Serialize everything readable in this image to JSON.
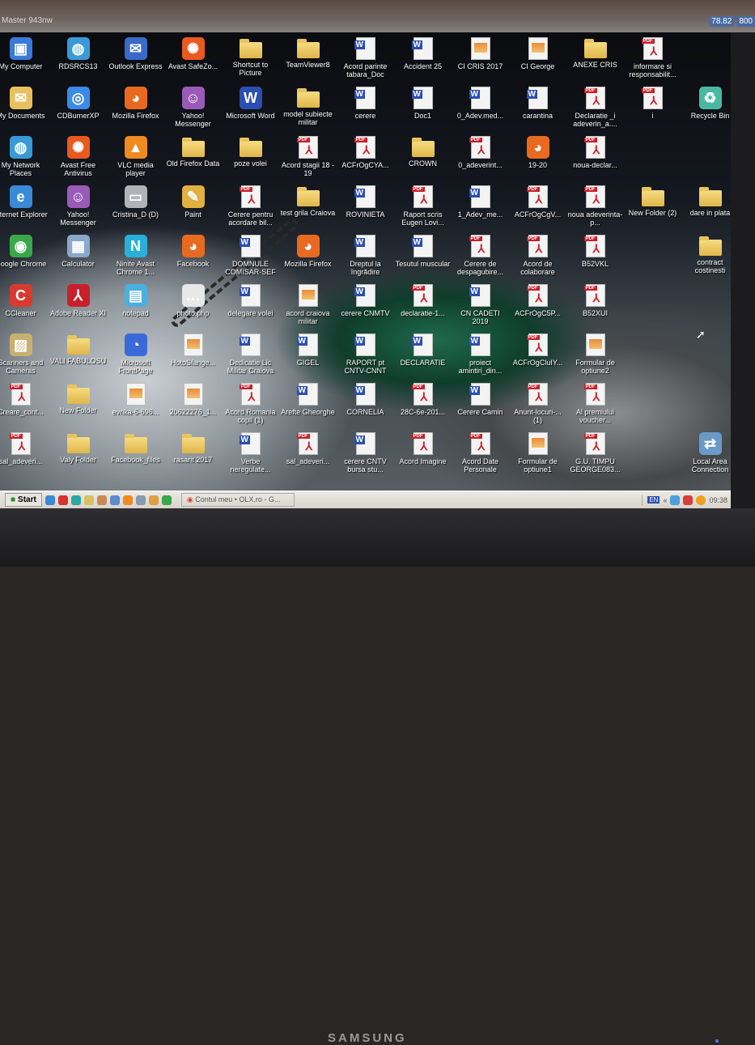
{
  "monitor": {
    "model": "Master 943nw",
    "osd": [
      "78.82",
      "800"
    ],
    "brand": "SAMSUNG"
  },
  "desktop": {
    "rows": [
      [
        {
          "label": "My Computer",
          "icon": "computer"
        },
        {
          "label": "RDSRCS13",
          "icon": "network"
        },
        {
          "label": "Outlook Express",
          "icon": "outlook"
        },
        {
          "label": "Avast SafeZo...",
          "icon": "avast"
        },
        {
          "label": "Shortcut to Picture",
          "icon": "folder"
        },
        {
          "label": "TeamViewer8",
          "icon": "folder"
        },
        {
          "label": "Acord parinte tabara_Doc",
          "icon": "word"
        },
        {
          "label": "Accident 25",
          "icon": "word"
        },
        {
          "label": "CI CRIS 2017",
          "icon": "img"
        },
        {
          "label": "CI George",
          "icon": "img"
        },
        {
          "label": "ANEXE CRIS",
          "icon": "folder"
        },
        {
          "label": "informare si responsabilit...",
          "icon": "pdf"
        },
        null
      ],
      [
        {
          "label": "My Documents",
          "icon": "documents"
        },
        {
          "label": "CDBurnerXP",
          "icon": "cdburner"
        },
        {
          "label": "Mozilla Firefox",
          "icon": "firefox"
        },
        {
          "label": "Yahoo! Messenger",
          "icon": "yahoo"
        },
        {
          "label": "Microsoft Word",
          "icon": "msword"
        },
        {
          "label": "model subiecte militar",
          "icon": "folder"
        },
        {
          "label": "cerere",
          "icon": "word"
        },
        {
          "label": "Doc1",
          "icon": "word"
        },
        {
          "label": "0_Adev.med...",
          "icon": "word"
        },
        {
          "label": "carantina",
          "icon": "word"
        },
        {
          "label": "Declaratie _i adeverin_a....",
          "icon": "pdf"
        },
        {
          "label": "i",
          "icon": "pdf"
        },
        {
          "label": "Recycle Bin",
          "icon": "recycle"
        }
      ],
      [
        {
          "label": "My Network Places",
          "icon": "network"
        },
        {
          "label": "Avast Free Antivirus",
          "icon": "avast"
        },
        {
          "label": "VLC media player",
          "icon": "vlc"
        },
        {
          "label": "Old Firefox Data",
          "icon": "folder"
        },
        {
          "label": "poze volei",
          "icon": "folder"
        },
        {
          "label": "Acord stagii 18 - 19",
          "icon": "pdf"
        },
        {
          "label": "ACFrOgCYA...",
          "icon": "pdf"
        },
        {
          "label": "CROWN",
          "icon": "folder"
        },
        {
          "label": "0_adeverint...",
          "icon": "pdf"
        },
        {
          "label": "19-20",
          "icon": "firefox"
        },
        {
          "label": "noua-declar...",
          "icon": "pdf"
        },
        null,
        null
      ],
      [
        {
          "label": "Internet Explorer",
          "icon": "ie"
        },
        {
          "label": "Yahoo! Messenger",
          "icon": "yahoo"
        },
        {
          "label": "Cristina_D (D)",
          "icon": "drive"
        },
        {
          "label": "Paint",
          "icon": "paint"
        },
        {
          "label": "Cerere pentru acordare bil...",
          "icon": "pdf"
        },
        {
          "label": "test grila Craiova",
          "icon": "folder"
        },
        {
          "label": "ROVINIETA",
          "icon": "word"
        },
        {
          "label": "Raport scris Eugen Lovi...",
          "icon": "pdf"
        },
        {
          "label": "1_Adev_me...",
          "icon": "word"
        },
        {
          "label": "ACFrOgCgV...",
          "icon": "pdf"
        },
        {
          "label": "noua adeverinta-p...",
          "icon": "pdf"
        },
        {
          "label": "New Folder (2)",
          "icon": "folder"
        },
        {
          "label": "dare in plata",
          "icon": "folder"
        }
      ],
      [
        {
          "label": "Google Chrome",
          "icon": "chrome"
        },
        {
          "label": "Calculator",
          "icon": "calculator"
        },
        {
          "label": "Ninite Avast Chrome 1...",
          "icon": "ninite"
        },
        {
          "label": "Facebook",
          "icon": "firefox"
        },
        {
          "label": "DOMNULE COMISAR-SEF",
          "icon": "word"
        },
        {
          "label": "Mozilla Firefox",
          "icon": "firefox"
        },
        {
          "label": "Dreptul la îngrădire",
          "icon": "word"
        },
        {
          "label": "Tesutul muscular",
          "icon": "word"
        },
        {
          "label": "Cerere de despagubire...",
          "icon": "pdf"
        },
        {
          "label": "Acord de colaborare",
          "icon": "pdf"
        },
        {
          "label": "B52VKL",
          "icon": "pdf"
        },
        null,
        {
          "label": "contract costinesti",
          "icon": "folder"
        }
      ],
      [
        {
          "label": "CCleaner",
          "icon": "ccleaner"
        },
        {
          "label": "Adobe Reader XI",
          "icon": "adobe"
        },
        {
          "label": "notepad",
          "icon": "notepad"
        },
        {
          "label": "photo.php",
          "icon": "file"
        },
        {
          "label": "delegare volei",
          "icon": "word"
        },
        {
          "label": "acord craiova militar",
          "icon": "img"
        },
        {
          "label": "cerere CNMTV",
          "icon": "word"
        },
        {
          "label": "declaratie-1...",
          "icon": "pdf"
        },
        {
          "label": "CN CADETI 2019",
          "icon": "word"
        },
        {
          "label": "ACFrOgC5P...",
          "icon": "pdf"
        },
        {
          "label": "B52XUI",
          "icon": "pdf"
        },
        null,
        null
      ],
      [
        {
          "label": "Scanners and Cameras",
          "icon": "scanner"
        },
        {
          "label": "VALI FABULOSU",
          "icon": "folder"
        },
        {
          "label": "Microsoft FrontPage",
          "icon": "frontpage"
        },
        {
          "label": "HotoSfange...",
          "icon": "img"
        },
        {
          "label": "Dedicatie Lic Militar Craiova",
          "icon": "word"
        },
        {
          "label": "GIGEL",
          "icon": "word"
        },
        {
          "label": "RAPORT pt CNTV-CNNT",
          "icon": "word"
        },
        {
          "label": "DECLARATIE",
          "icon": "word"
        },
        {
          "label": "proiect amintiri_din...",
          "icon": "word"
        },
        {
          "label": "ACFrOgCluIY...",
          "icon": "pdf"
        },
        {
          "label": "Formular de optiune2",
          "icon": "img"
        },
        null,
        null
      ],
      [
        {
          "label": "Creare_cont...",
          "icon": "pdf"
        },
        {
          "label": "New Folder",
          "icon": "folder"
        },
        {
          "label": "evrika-6-696...",
          "icon": "img"
        },
        {
          "label": "20622276_1...",
          "icon": "img"
        },
        {
          "label": "Acord Romania copil (1)",
          "icon": "pdf"
        },
        {
          "label": "Arefte Gheorghe",
          "icon": "word"
        },
        {
          "label": "CORNELIA",
          "icon": "word"
        },
        {
          "label": "28C-6e-201...",
          "icon": "pdf"
        },
        {
          "label": "Cerere Camin",
          "icon": "word"
        },
        {
          "label": "Anunt-locuri-... (1)",
          "icon": "pdf"
        },
        {
          "label": "Al premiului voucher...",
          "icon": "pdf"
        },
        null,
        null
      ],
      [
        {
          "label": "sal_adeveri...",
          "icon": "pdf"
        },
        {
          "label": "Valy Folder",
          "icon": "folder"
        },
        {
          "label": "Facebook_files",
          "icon": "folder"
        },
        {
          "label": "rasarit 2017",
          "icon": "folder"
        },
        {
          "label": "Verbe neregulate...",
          "icon": "word"
        },
        {
          "label": "sal_adeveri...",
          "icon": "pdf"
        },
        {
          "label": "cerere CNTV bursa stu...",
          "icon": "word"
        },
        {
          "label": "Acord Imagine",
          "icon": "pdf"
        },
        {
          "label": "Acord Date Personale",
          "icon": "pdf"
        },
        {
          "label": "Formular de optiune1",
          "icon": "img"
        },
        {
          "label": "G.U. TIMPU GEORGE083...",
          "icon": "pdf"
        },
        null,
        {
          "label": "Local Area Connection",
          "icon": "lan"
        }
      ]
    ]
  },
  "taskbar": {
    "start": "Start",
    "window": "Contul meu • OLX.ro - G...",
    "lang": "EN",
    "clock": "09:38"
  },
  "colors": {
    "taskbar": "#d8d4cc",
    "word": "#2b4fb0",
    "pdf": "#c8202a",
    "folder": "#e0b64a"
  }
}
